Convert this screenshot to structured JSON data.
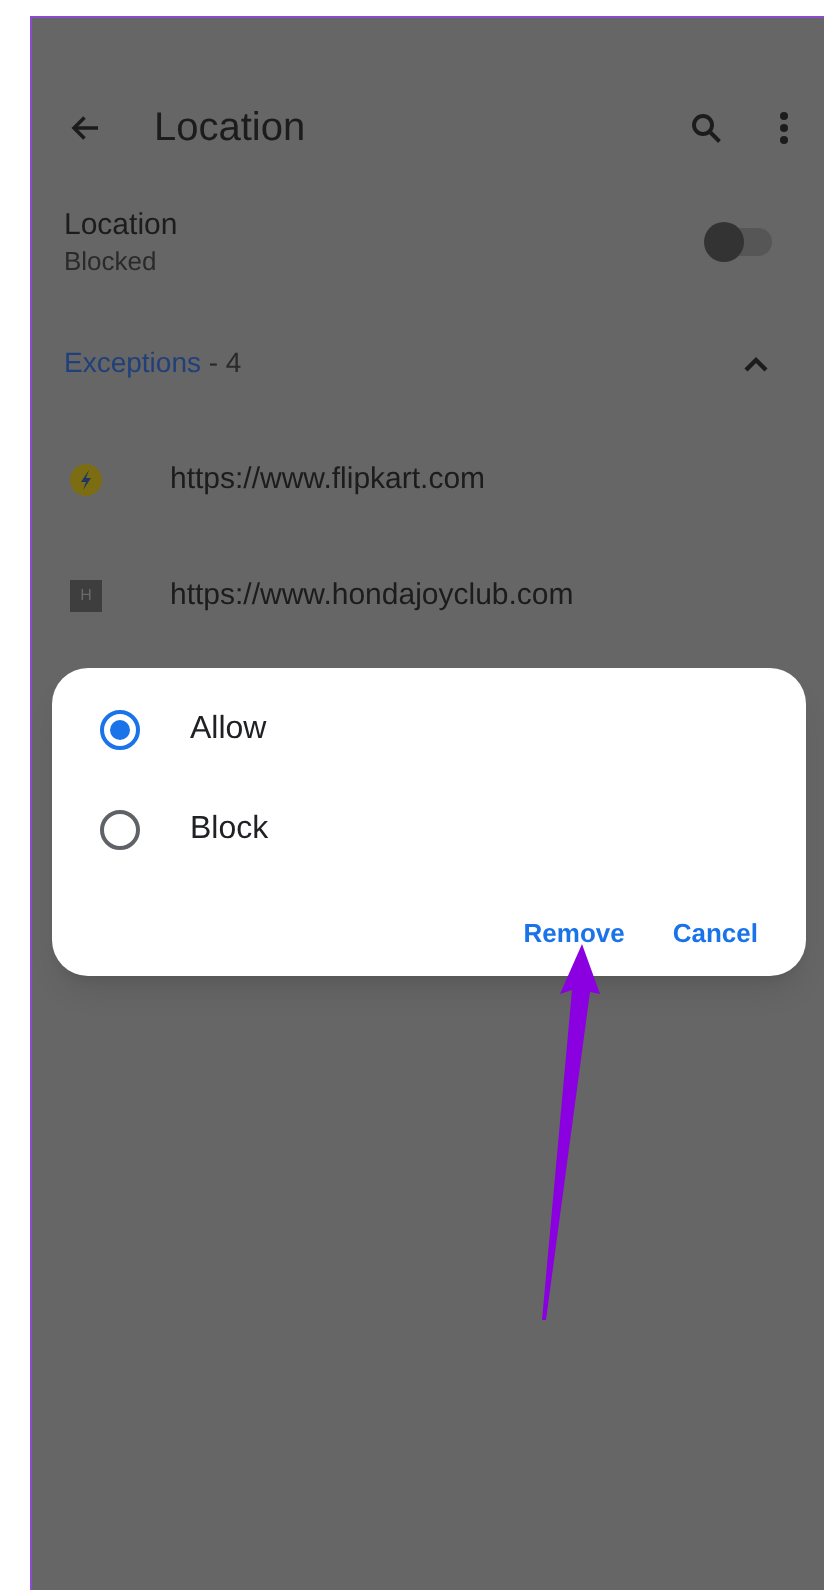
{
  "app_bar": {
    "title": "Location"
  },
  "setting": {
    "title": "Location",
    "subtitle": "Blocked",
    "on": false
  },
  "exceptions": {
    "label": "Exceptions",
    "count": " - 4",
    "expanded": true
  },
  "sites": [
    {
      "kind": "flipkart",
      "url": "https://www.flipkart.com"
    },
    {
      "kind": "letter",
      "letter": "H",
      "url": "https://www.hondajoyclub.com"
    }
  ],
  "dialog": {
    "options": [
      {
        "label": "Allow",
        "selected": true
      },
      {
        "label": "Block",
        "selected": false
      }
    ],
    "buttons": [
      "Remove",
      "Cancel"
    ]
  }
}
